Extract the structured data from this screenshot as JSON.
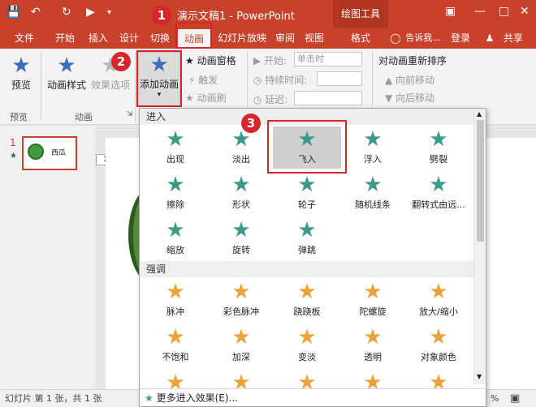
{
  "titlebar": {
    "title": "演示文稿1 - PowerPoint",
    "drawing_tools": "绘图工具"
  },
  "tabs": [
    "文件",
    "开始",
    "插入",
    "设计",
    "切换",
    "动画",
    "幻灯片放映",
    "审阅",
    "视图",
    "格式"
  ],
  "tell_me": "告诉我...",
  "login": "登录",
  "share": "共享",
  "ribbon": {
    "preview": "预览",
    "animation_styles": "动画样式",
    "effect_options": "效果选项",
    "add_animation": "添加动画",
    "animation_pane": "动画窗格",
    "trigger": "触发",
    "animation_painter": "动画刷",
    "start_label": "开始:",
    "start_value": "单击时",
    "duration_label": "持续时间:",
    "delay_label": "延迟:",
    "reorder_title": "对动画重新排序",
    "move_earlier": "向前移动",
    "move_later": "向后移动",
    "group_preview": "预览",
    "group_animation": "动画"
  },
  "slide_panel": {
    "slide_number": "1",
    "thumb_text": "西瓜",
    "placeholder_number": "1"
  },
  "gallery": {
    "section_entrance": "进入",
    "entrance_items": [
      "出现",
      "淡出",
      "飞入",
      "浮入",
      "劈裂",
      "擦除",
      "形状",
      "轮子",
      "随机线条",
      "翻转式由远...",
      "缩放",
      "旋转",
      "弹跳"
    ],
    "section_emphasis": "强调",
    "emphasis_items": [
      "脉冲",
      "彩色脉冲",
      "跷跷板",
      "陀螺旋",
      "放大/缩小",
      "不饱和",
      "加深",
      "变淡",
      "透明",
      "对象颜色",
      "",
      "",
      "",
      "",
      ""
    ],
    "more_entrance": "更多进入效果(E)..."
  },
  "status": {
    "slide_info": "幻灯片 第 1 张，共 1 张",
    "zoom": "%"
  },
  "markers": [
    "1",
    "2",
    "3"
  ],
  "colors": {
    "accent": "#c8412b",
    "entrance_star": "#3c9a8a",
    "emphasis_star": "#e8a33a",
    "marker": "#d6262b"
  }
}
